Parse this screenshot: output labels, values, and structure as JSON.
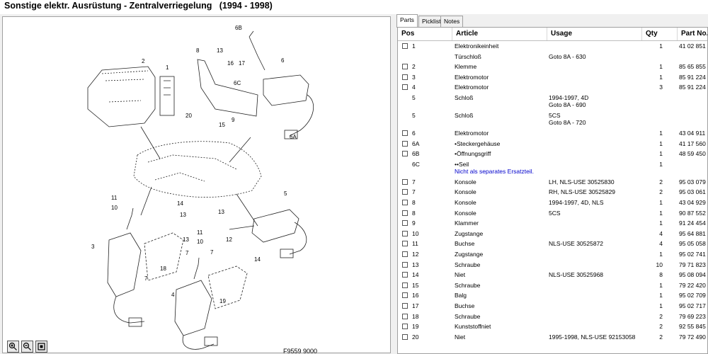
{
  "window": {
    "title": "Sonstige elektr. Ausrüstung - Zentralverriegelung   (1994 - 1998)"
  },
  "drawing": {
    "reference": "F9559 9000",
    "callouts": [
      "1",
      "2",
      "3",
      "4",
      "5",
      "6",
      "6A",
      "6B",
      "6C",
      "7",
      "7",
      "7",
      "8",
      "9",
      "10",
      "10",
      "11",
      "11",
      "12",
      "13",
      "13",
      "13",
      "13",
      "14",
      "14",
      "15",
      "16",
      "17",
      "18",
      "19",
      "20"
    ]
  },
  "zoom": {
    "zoom_in": "zoom-in",
    "zoom_out": "zoom-out",
    "fit": "fit"
  },
  "tabs": [
    {
      "label": "Parts"
    },
    {
      "label": "Picklist"
    },
    {
      "label": "Notes"
    }
  ],
  "table": {
    "columns": [
      "Pos",
      "Article",
      "Usage",
      "Qty",
      "Part No."
    ],
    "rows": [
      {
        "check": true,
        "pos": "1",
        "article": "Elektronikeinheit",
        "usage": "",
        "qty": "1",
        "part": "41 02 851"
      },
      {
        "check": false,
        "pos": "",
        "article": "Türschloß",
        "usage": "Goto 8A - 630",
        "qty": "",
        "part": ""
      },
      {
        "check": true,
        "pos": "2",
        "article": "Klemme",
        "usage": "",
        "qty": "1",
        "part": "85 65 855"
      },
      {
        "check": true,
        "pos": "3",
        "article": "Elektromotor",
        "usage": "",
        "qty": "1",
        "part": "85 91 224"
      },
      {
        "check": true,
        "pos": "4",
        "article": "Elektromotor",
        "usage": "",
        "qty": "3",
        "part": "85 91 224"
      },
      {
        "check": false,
        "pos": "5",
        "article": "Schloß",
        "usage": "1994-1997, 4D\nGoto 8A - 690",
        "qty": "",
        "part": ""
      },
      {
        "check": false,
        "pos": "5",
        "article": "Schloß",
        "usage": "5CS\nGoto 8A - 720",
        "qty": "",
        "part": ""
      },
      {
        "check": true,
        "pos": "6",
        "article": "Elektromotor",
        "usage": "",
        "qty": "1",
        "part": "43 04 911"
      },
      {
        "check": true,
        "pos": "6A",
        "article": "•Steckergehäuse",
        "usage": "",
        "qty": "1",
        "part": "41 17 560"
      },
      {
        "check": true,
        "pos": "6B",
        "article": "•Öffnungsgriff",
        "usage": "",
        "qty": "1",
        "part": "48 59 450"
      },
      {
        "check": false,
        "pos": "6C",
        "article": "••Seil",
        "note": "Nicht als separates Ersatzteil.",
        "usage": "",
        "qty": "1",
        "part": ""
      },
      {
        "check": true,
        "pos": "7",
        "article": "Konsole",
        "usage": "LH, NLS-USE 30525830",
        "qty": "2",
        "part": "95 03 079"
      },
      {
        "check": true,
        "pos": "7",
        "article": "Konsole",
        "usage": "RH, NLS-USE 30525829",
        "qty": "2",
        "part": "95 03 061"
      },
      {
        "check": true,
        "pos": "8",
        "article": "Konsole",
        "usage": "1994-1997, 4D, NLS",
        "qty": "1",
        "part": "43 04 929"
      },
      {
        "check": true,
        "pos": "8",
        "article": "Konsole",
        "usage": "5CS",
        "qty": "1",
        "part": "90 87 552"
      },
      {
        "check": true,
        "pos": "9",
        "article": "Klammer",
        "usage": "",
        "qty": "1",
        "part": "91 24 454"
      },
      {
        "check": true,
        "pos": "10",
        "article": "Zugstange",
        "usage": "",
        "qty": "4",
        "part": "95 64 881"
      },
      {
        "check": true,
        "pos": "11",
        "article": "Buchse",
        "usage": "NLS-USE 30525872",
        "qty": "4",
        "part": "95 05 058"
      },
      {
        "check": true,
        "pos": "12",
        "article": "Zugstange",
        "usage": "",
        "qty": "1",
        "part": "95 02 741"
      },
      {
        "check": true,
        "pos": "13",
        "article": "Schraube",
        "usage": "",
        "qty": "10",
        "part": "79 71 823"
      },
      {
        "check": true,
        "pos": "14",
        "article": "Niet",
        "usage": "NLS-USE 30525968",
        "qty": "8",
        "part": "95 08 094"
      },
      {
        "check": true,
        "pos": "15",
        "article": "Schraube",
        "usage": "",
        "qty": "1",
        "part": "79 22 420"
      },
      {
        "check": true,
        "pos": "16",
        "article": "Balg",
        "usage": "",
        "qty": "1",
        "part": "95 02 709"
      },
      {
        "check": true,
        "pos": "17",
        "article": "Buchse",
        "usage": "",
        "qty": "1",
        "part": "95 02 717"
      },
      {
        "check": true,
        "pos": "18",
        "article": "Schraube",
        "usage": "",
        "qty": "2",
        "part": "79 69 223"
      },
      {
        "check": true,
        "pos": "19",
        "article": "Kunststoffniet",
        "usage": "",
        "qty": "2",
        "part": "92 55 845"
      },
      {
        "check": true,
        "pos": "20",
        "article": "Niet",
        "usage": "1995-1998, NLS-USE 92153058",
        "qty": "2",
        "part": "79 72 490"
      }
    ]
  }
}
